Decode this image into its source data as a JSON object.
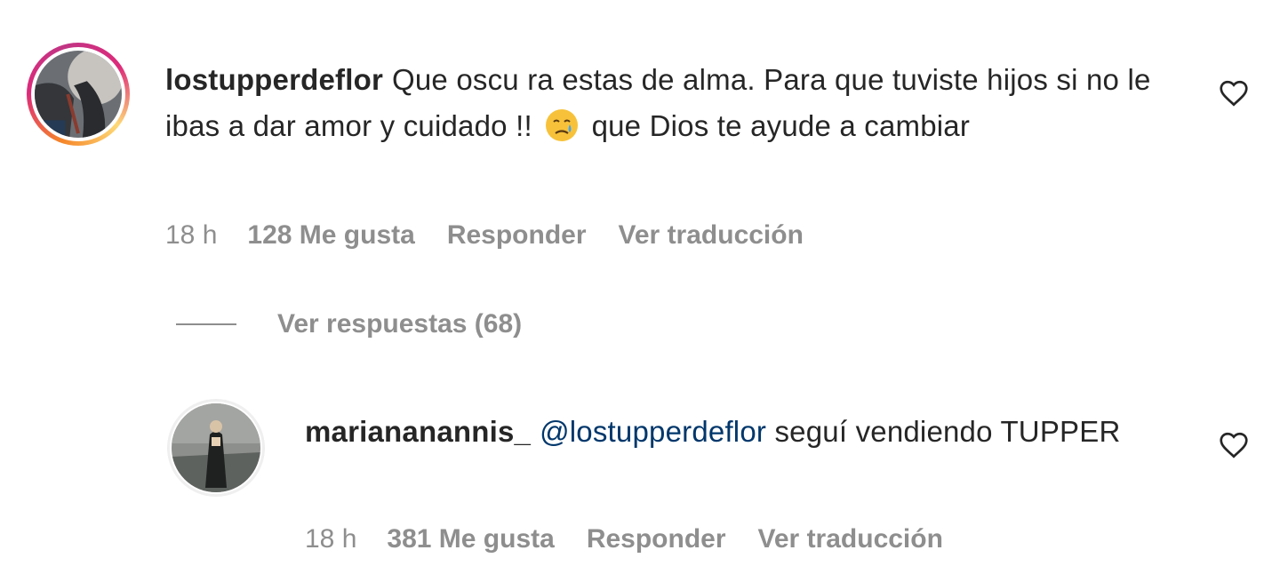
{
  "comment1": {
    "username": "lostupperdeflor",
    "text_part1": "Que oscu ra estas de alma. Para que tuviste hijos si no le ibas a dar amor y cuidado !!",
    "emoji": "crying-face",
    "text_part2": "que Dios te ayude a cambiar",
    "time": "18 h",
    "likes": "128 Me gusta",
    "reply_label": "Responder",
    "translate_label": "Ver traducción",
    "like_icon": "heart-outline-icon"
  },
  "replies_toggle": {
    "label": "Ver respuestas (68)"
  },
  "comment2": {
    "username": "mariananannis_",
    "mention": "@lostupperdeflor",
    "text": "seguí vendiendo TUPPER",
    "time": "18 h",
    "likes": "381 Me gusta",
    "reply_label": "Responder",
    "translate_label": "Ver traducción",
    "like_icon": "heart-outline-icon"
  },
  "colors": {
    "text": "#262626",
    "secondary": "#8e8e8e",
    "mention": "#00376b",
    "story_ring": "#dd2a7b"
  }
}
